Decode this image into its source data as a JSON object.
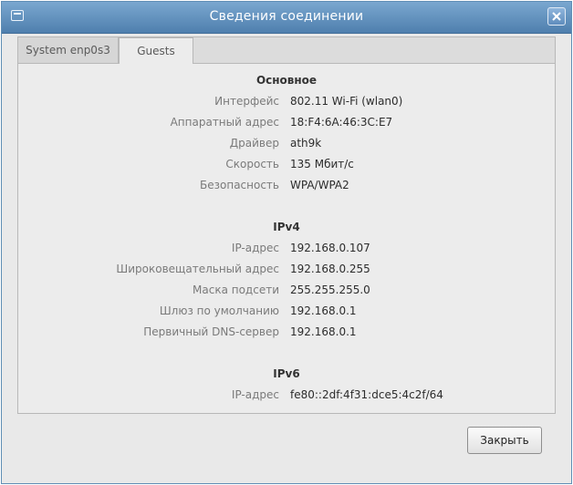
{
  "window": {
    "title": "Сведения соединении"
  },
  "tabs": [
    {
      "label": "System enp0s3"
    },
    {
      "label": "Guests"
    }
  ],
  "sections": {
    "main": {
      "title": "Основное",
      "rows": [
        {
          "label": "Интерфейс",
          "value": "802.11 Wi-Fi (wlan0)"
        },
        {
          "label": "Аппаратный адрес",
          "value": "18:F4:6A:46:3C:E7"
        },
        {
          "label": "Драйвер",
          "value": "ath9k"
        },
        {
          "label": "Скорость",
          "value": "135 Мбит/с"
        },
        {
          "label": "Безопасность",
          "value": "WPA/WPA2"
        }
      ]
    },
    "ipv4": {
      "title": "IPv4",
      "rows": [
        {
          "label": "IP-адрес",
          "value": "192.168.0.107"
        },
        {
          "label": "Широковещательный адрес",
          "value": "192.168.0.255"
        },
        {
          "label": "Маска подсети",
          "value": "255.255.255.0"
        },
        {
          "label": "Шлюз по умолчанию",
          "value": "192.168.0.1"
        },
        {
          "label": "Первичный DNS-сервер",
          "value": "192.168.0.1"
        }
      ]
    },
    "ipv6": {
      "title": "IPv6",
      "rows": [
        {
          "label": "IP-адрес",
          "value": "fe80::2df:4f31:dce5:4c2f/64"
        }
      ]
    }
  },
  "footer": {
    "close_label": "Закрыть"
  },
  "icons": {
    "window": "network-window-icon",
    "close": "close-icon"
  },
  "colors": {
    "titlebar": "#5f8eb5",
    "panel": "#ececec"
  }
}
